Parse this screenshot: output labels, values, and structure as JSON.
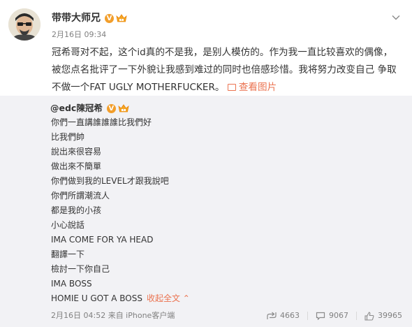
{
  "post": {
    "author": "带带大师兄",
    "verified_badge": "V",
    "time": "2月16日 09:34",
    "text": "冠希哥对不起，这个id真的不是我，是别人模仿的。作为我一直比较喜欢的偶像，被您点名批评了一下外貌让我感到难过的同时也倍感珍惜。我将努力改变自己 争取不做一个FAT UGLY MOTHERFUCKER。",
    "view_image_label": "查看图片",
    "menu_icon": "chevron-down-icon"
  },
  "repost": {
    "author": "@edc陳冠希",
    "verified_badge": "V",
    "lines": [
      "你們一直講誰誰誰比我們好",
      "比我們帥",
      "說出來很容易",
      "做出來不簡單",
      "你們做到我的LEVEL才跟我說吧",
      "你們所謂潮流人",
      "都是我的小孩",
      "小心說話",
      "IMA COME FOR YA HEAD",
      "翻譯一下",
      "檢討一下你自己",
      "IMA BOSS"
    ],
    "last_line": "HOMIE U GOT A BOSS",
    "collapse_label": "收起全文 ⌃",
    "time_source": "2月16日 04:52 来自 iPhone客户端",
    "shares": "4663",
    "comments": "9067",
    "likes": "39965"
  },
  "colors": {
    "link_accent": "#eb7350",
    "repost_background": "#f2f2f5",
    "verified_badge": "#f29e2b",
    "muted_text": "#808080"
  }
}
